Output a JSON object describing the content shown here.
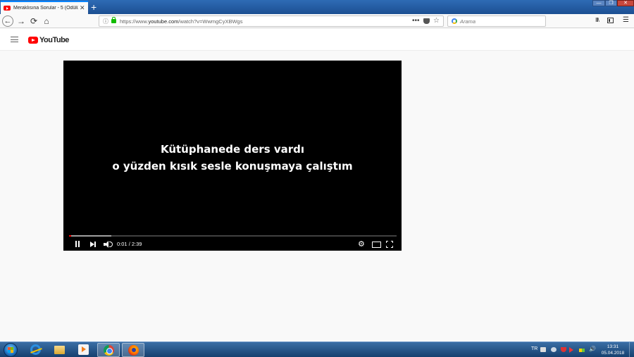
{
  "browser": {
    "tab": {
      "title": "Meraklısına Sorular - 5 (Ödülü",
      "close": "✕"
    },
    "new_tab": "+",
    "nav": {
      "back": "←",
      "forward": "→",
      "reload": "⟳",
      "home": "⌂"
    },
    "url": {
      "info": "ⓘ",
      "prefix": "https://www.",
      "domain": "youtube.com",
      "path": "/watch?v=WwmgCyXBWgs",
      "more": "•••",
      "bookmark": "☆"
    },
    "search": {
      "placeholder": "Arama"
    },
    "library": "III\\",
    "menu": "☰",
    "window": {
      "minimize": "—",
      "maximize": "❐",
      "close": "✕"
    }
  },
  "youtube": {
    "logo_text": "YouTube"
  },
  "player": {
    "subtitle_line1": "Kütüphanede ders vardı",
    "subtitle_line2": "o yüzden kısık sesle konuşmaya çalıştım",
    "time_current": "0:01",
    "time_separator": " / ",
    "time_total": "2:39",
    "settings": "⚙",
    "progress_played_fraction": 0.006,
    "progress_buffered_fraction": 0.13,
    "accent": "#ff0000"
  },
  "taskbar": {
    "language": "TR",
    "volume": "🔊",
    "clock_time": "13:31",
    "clock_date": "05.04.2018"
  }
}
